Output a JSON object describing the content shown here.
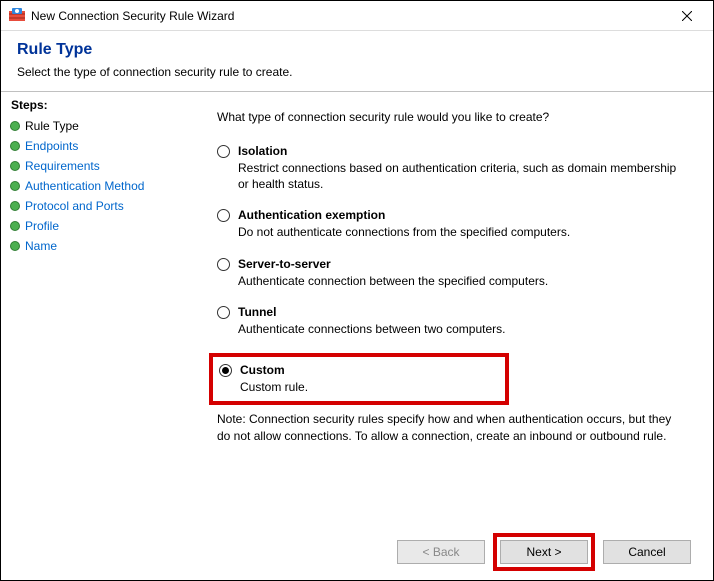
{
  "window": {
    "title": "New Connection Security Rule Wizard"
  },
  "header": {
    "title": "Rule Type",
    "subtitle": "Select the type of connection security rule to create."
  },
  "sidebar": {
    "header": "Steps:",
    "items": [
      {
        "label": "Rule Type",
        "current": true
      },
      {
        "label": "Endpoints"
      },
      {
        "label": "Requirements"
      },
      {
        "label": "Authentication Method"
      },
      {
        "label": "Protocol and Ports"
      },
      {
        "label": "Profile"
      },
      {
        "label": "Name"
      }
    ]
  },
  "main": {
    "question": "What type of connection security rule would you like to create?",
    "options": [
      {
        "id": "isolation",
        "label": "Isolation",
        "desc": "Restrict connections based on authentication criteria, such as domain membership or health status.",
        "checked": false
      },
      {
        "id": "auth-exemption",
        "label": "Authentication exemption",
        "desc": "Do not authenticate connections from the specified computers.",
        "checked": false
      },
      {
        "id": "server-to-server",
        "label": "Server-to-server",
        "desc": "Authenticate connection between the specified computers.",
        "checked": false
      },
      {
        "id": "tunnel",
        "label": "Tunnel",
        "desc": "Authenticate connections between two computers.",
        "checked": false
      },
      {
        "id": "custom",
        "label": "Custom",
        "desc": "Custom rule.",
        "checked": true,
        "highlighted": true
      }
    ],
    "note": "Note:  Connection security rules specify how and when authentication occurs, but they do not allow connections.  To allow a connection, create an inbound or outbound rule."
  },
  "footer": {
    "back": "< Back",
    "next": "Next >",
    "cancel": "Cancel",
    "back_enabled": false,
    "next_highlighted": true
  }
}
